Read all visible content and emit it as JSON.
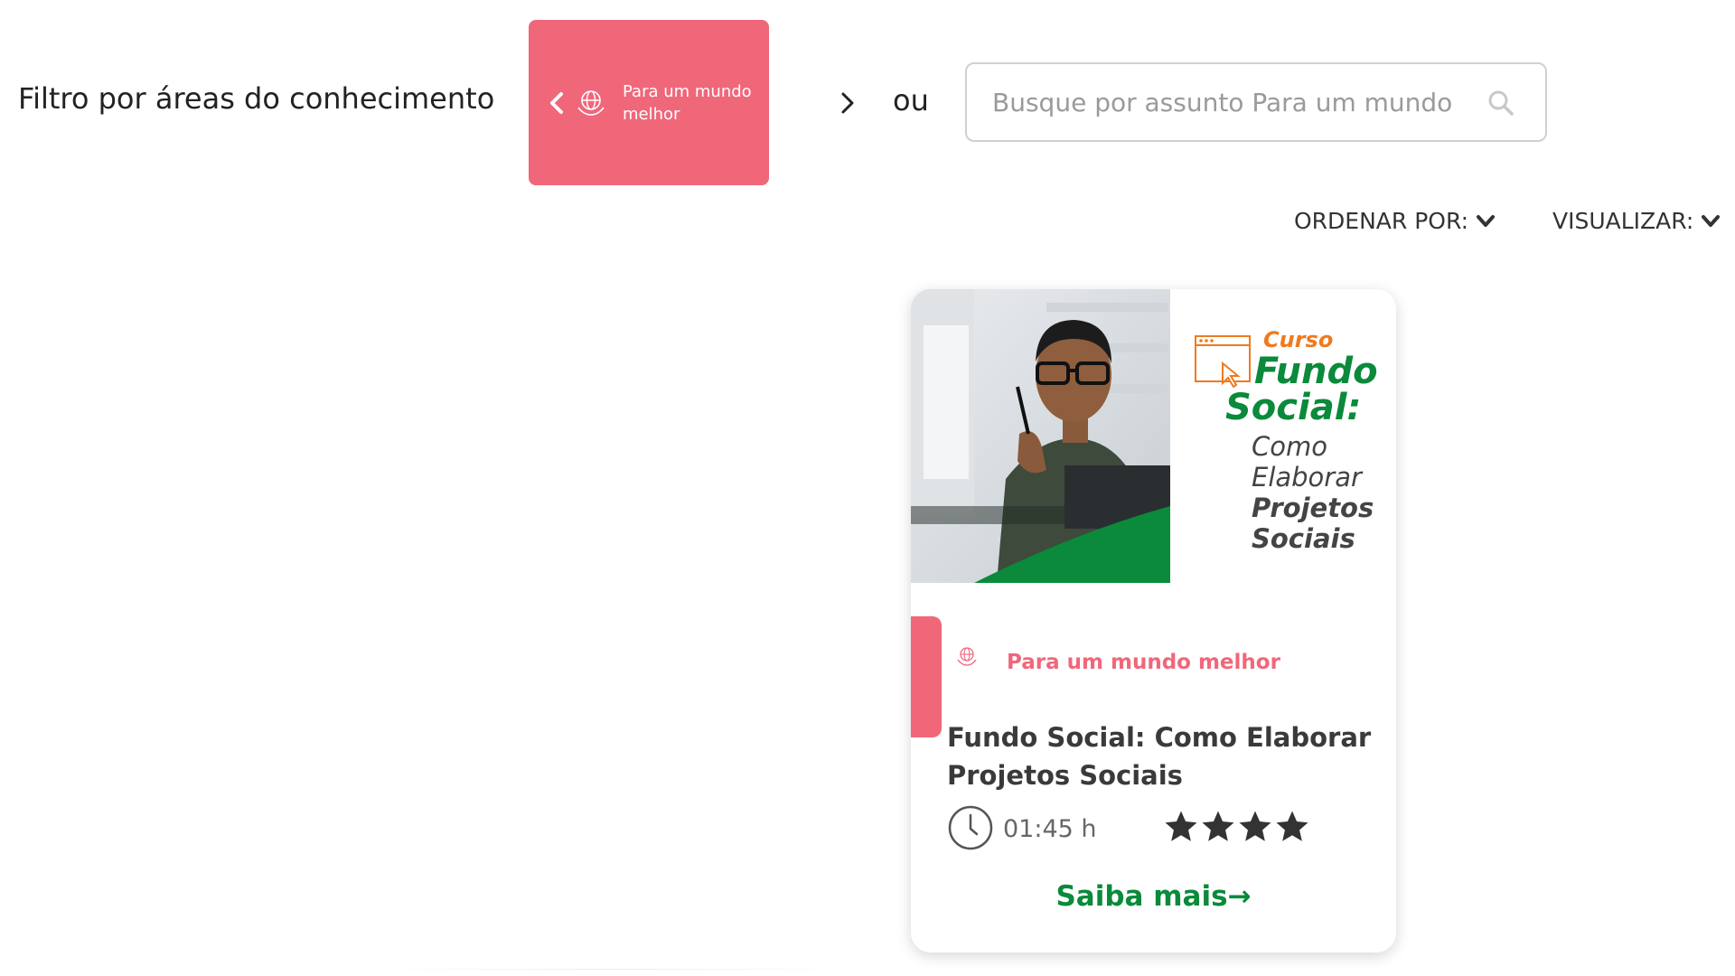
{
  "filter": {
    "label": "Filtro por áreas do conhecimento",
    "selected_category": "Para um mundo melhor",
    "category_icon": "globe-hands-icon"
  },
  "or_text": "ou",
  "search": {
    "placeholder": "Busque por assunto Para um mundo melhor"
  },
  "controls": {
    "sort_label": "ORDENAR POR:",
    "view_label": "VISUALIZAR:"
  },
  "course": {
    "image_badge": "Curso",
    "image_title_line1": "Fundo",
    "image_title_line2": "Social:",
    "image_subtitle_1": "Como",
    "image_subtitle_2": "Elaborar",
    "image_subtitle_3": "Projetos",
    "image_subtitle_4": "Sociais",
    "category": "Para um mundo melhor",
    "title": "Fundo Social: Como Elaborar Projetos Sociais",
    "duration": "01:45 h",
    "rating_stars": 4,
    "cta": "Saiba mais→"
  },
  "colors": {
    "accent_pink": "#f0677a",
    "brand_green": "#0a8a3a",
    "image_orange": "#f07a1e"
  }
}
